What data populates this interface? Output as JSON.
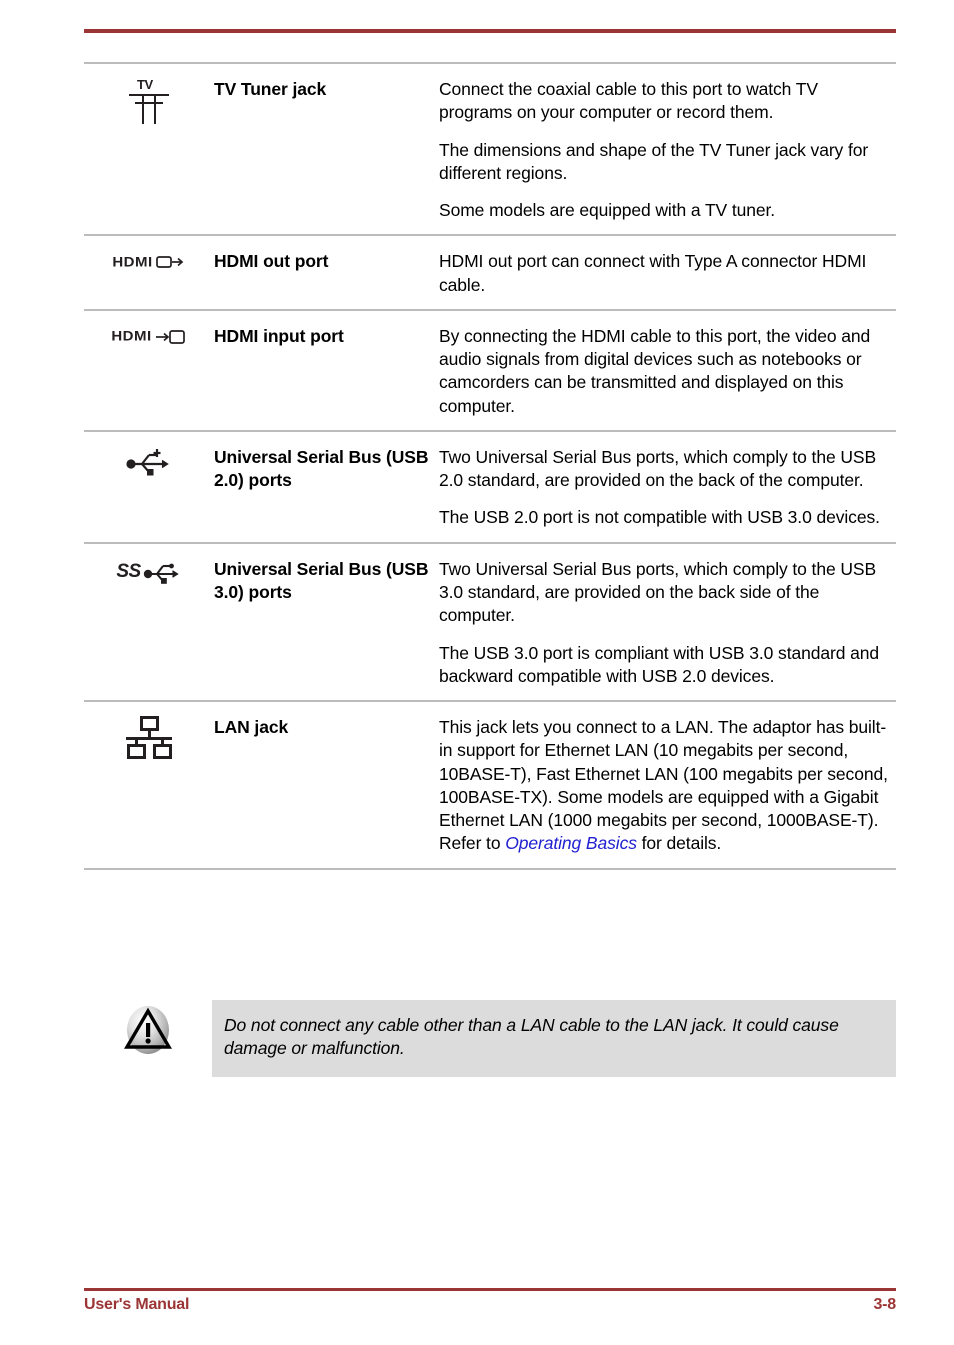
{
  "document": {
    "footer_left": "User's Manual",
    "page_number": "3-8",
    "accent_color": "#9b3535",
    "link_color": "#2020d0",
    "caution_bg_color": "#dcdcdc"
  },
  "table": {
    "rows": [
      {
        "icon": "tv-antenna-icon",
        "name": "TV Tuner jack",
        "paragraphs": [
          "Connect the coaxial cable to this port to watch TV programs on your computer or record them.",
          "The dimensions and shape of the TV Tuner jack vary for different regions.",
          "Some models are equipped with a TV tuner."
        ]
      },
      {
        "icon": "hdmi-out-icon",
        "icon_text": "HDMI",
        "name": "HDMI out port",
        "paragraphs": [
          "HDMI out port can connect with Type A connector HDMI cable."
        ]
      },
      {
        "icon": "hdmi-input-icon",
        "icon_text": "HDMI",
        "name": "HDMI input port",
        "paragraphs": [
          "By connecting the HDMI cable to this port, the video and audio signals from digital devices such as notebooks or camcorders can be transmitted and displayed on this computer."
        ]
      },
      {
        "icon": "usb-trident-icon",
        "name": "Universal Serial Bus (USB 2.0) ports",
        "paragraphs": [
          "Two Universal Serial Bus ports, which comply to the USB 2.0 standard, are provided on the back of the computer.",
          "The USB 2.0 port is not compatible with USB 3.0 devices."
        ]
      },
      {
        "icon": "usb-superspeed-icon",
        "icon_text": "SS",
        "name": "Universal Serial Bus (USB 3.0) ports",
        "paragraphs": [
          "Two Universal Serial Bus ports, which comply to the USB 3.0 standard, are provided on the back side of the computer.",
          "The USB 3.0 port is compliant with USB 3.0 standard and backward compatible with USB 2.0 devices."
        ]
      },
      {
        "icon": "lan-network-icon",
        "name": "LAN jack",
        "paragraphs": [
          "This jack lets you connect to a LAN. The adaptor has built-in support for Ethernet LAN (10 megabits per second, 10BASE-T), Fast Ethernet LAN (100 megabits per second, 100BASE-TX). Some models are equipped with a Gigabit Ethernet LAN (1000 megabits per second, 1000BASE-T). Refer to "
        ],
        "link_text": "Operating Basics",
        "paragraph_tail": " for details."
      }
    ]
  },
  "caution": {
    "icon": "warning-triangle-icon",
    "text": "Do not connect any cable other than a LAN cable to the LAN jack. It could cause damage or malfunction."
  }
}
